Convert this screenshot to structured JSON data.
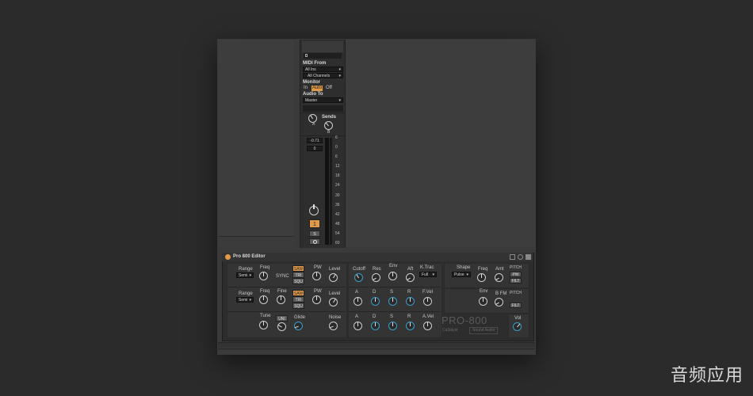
{
  "track": {
    "midi_from": "MIDI From",
    "midi_from_value": "All Ins",
    "channels_value": "All Channels",
    "monitor": "Monitor",
    "monitor_options": [
      "In",
      "Auto",
      "Off"
    ],
    "audio_to": "Audio To",
    "audio_to_value": "Master",
    "sends": "Sends",
    "send_a": "A",
    "send_b": "B",
    "volume_value": "-0.71",
    "pan_value": "0",
    "track_number": "1",
    "solo": "S",
    "arm_icon": "record-icon",
    "meter_scale": [
      "6",
      "0",
      "6",
      "12",
      "18",
      "24",
      "30",
      "36",
      "42",
      "48",
      "54",
      "60"
    ]
  },
  "device": {
    "title": "Pro 800 Editor",
    "osc1": {
      "range": "Range",
      "range_value": "Semi",
      "freq": "Freq",
      "sync": "SYNC",
      "waves": [
        "SAW",
        "TRI",
        "SQU"
      ],
      "pw": "PW",
      "level": "Level"
    },
    "osc2": {
      "range": "Range",
      "range_value": "Semi",
      "freq": "Freq",
      "fine": "Fine",
      "waves": [
        "SAW",
        "TRI",
        "SQU"
      ],
      "pw": "PW",
      "level": "Level"
    },
    "misc": {
      "tune": "Tune",
      "uni": "UNI",
      "glide": "Glide",
      "noise": "Noise"
    },
    "filter": {
      "cutoff": "Cutoff",
      "res": "Res",
      "env": "Env",
      "aft": "Aft",
      "ktrac": "K.Trac",
      "ktrac_value": "Full"
    },
    "filter_env": [
      "A",
      "D",
      "S",
      "R",
      "F.Vel"
    ],
    "amp_env": [
      "A",
      "D",
      "S",
      "R",
      "A.Vel"
    ],
    "lfo": {
      "shape": "Shape",
      "shape_value": "Pulse",
      "freq": "Freq",
      "amt": "Amt",
      "dest": [
        "PITCH",
        "PW",
        "FILT"
      ]
    },
    "polymod": {
      "env": "Env",
      "bfm": "B FM",
      "dest": [
        "PITCH",
        "FILT"
      ]
    },
    "brand": "PRO-800",
    "brand_sub1": "Ca3alyst",
    "brand_sub2": "Sound Audio",
    "vol": "Vol"
  },
  "watermark": "音频应用"
}
